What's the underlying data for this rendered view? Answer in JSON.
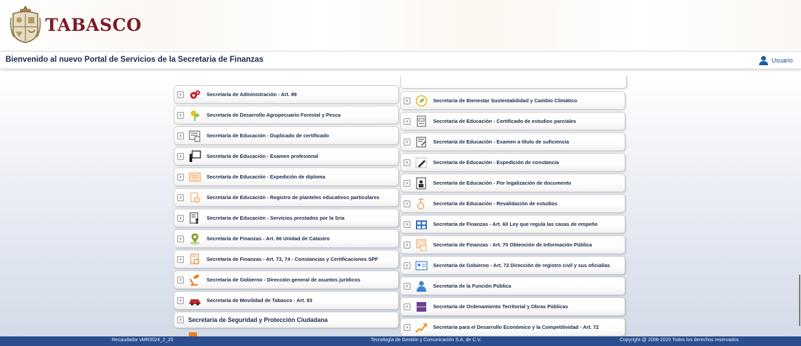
{
  "brand": {
    "name": "TABASCO"
  },
  "welcome": {
    "text": "Bienvenido al nuevo Portal de Servicios de la Secretaria de Finanzas"
  },
  "user": {
    "label": "Usuario",
    "icon": "user-icon"
  },
  "services_left": [
    {
      "label": "Secretaría de Administración - Art. 89",
      "icon": "gears-icon",
      "color": "#c4262e"
    },
    {
      "label": "Secretaría de Desarrollo Agropecuario Forestal y Pesca",
      "icon": "plant-icon",
      "color": "#ecc01d"
    },
    {
      "label": "Secretaría de Educación - Duplicado de certificado",
      "icon": "certificate-icon",
      "color": "#555555"
    },
    {
      "label": "Secretaría de Educación - Examen profesional",
      "icon": "presentation-icon",
      "color": "#2a2a2a"
    },
    {
      "label": "Secretaría de Educación - Expedición de diploma",
      "icon": "diploma-icon",
      "color": "#f0a360"
    },
    {
      "label": "Secretaría de Educación - Registro de planteles educativos particulares",
      "icon": "document-check-icon",
      "color": "#f0a360"
    },
    {
      "label": "Secretaría de Educación - Servicios prestados por la Sria",
      "icon": "document-person-icon",
      "color": "#333333"
    },
    {
      "label": "Secretaría de Finanzas - Art. 66 Unidad de Catastro",
      "icon": "map-pin-icon",
      "color": "#8aa030"
    },
    {
      "label": "Secretaría de Finanzas - Art. 73, 74 - Constancias y Certificaciones SPF",
      "icon": "certificate-seal-icon",
      "color": "#ee7d33"
    },
    {
      "label": "Secretaría de Gobierno - Dirección general de asuntos jurídicos",
      "icon": "gavel-icon",
      "color": "#f07e1e"
    },
    {
      "label": "Secretaría de Movilidad de Tabasco - Art. 93",
      "icon": "car-icon",
      "color": "#c4262e"
    },
    {
      "label": "Secretaría de Seguridad y Protección Ciudadana",
      "icon": "",
      "color": ""
    }
  ],
  "services_right": [
    {
      "label": "Secretaría de Bienestar Sustentabilidad y Cambio Climático",
      "icon": "eco-icon",
      "color": "#e3b726"
    },
    {
      "label": "Secretaría de Educación - Certificado de estudios parciales",
      "icon": "certificate-icon",
      "color": "#555555"
    },
    {
      "label": "Secretaría de Educación - Examen a título de suficiencia",
      "icon": "exam-icon",
      "color": "#444444"
    },
    {
      "label": "Secretaría de Educación - Expedición de constancia",
      "icon": "pen-icon",
      "color": "#333333"
    },
    {
      "label": "Secretaría de Educación - Por legalización de documento",
      "icon": "legal-document-icon",
      "color": "#333333"
    },
    {
      "label": "Secretaría de Educación - Revalidación de estudios",
      "icon": "validation-icon",
      "color": "#e79b5a"
    },
    {
      "label": "Secretaría de Finanzas - Art. 60 Ley que regula las casas de empeño",
      "icon": "building-icon",
      "color": "#2a6cc6"
    },
    {
      "label": "Secretaría de Finanzas - Art. 70 Obtención de Información Pública",
      "icon": "public-info-icon",
      "color": "#f0a360"
    },
    {
      "label": "Secretaría de Gobierno - Art. 72 Dirección de registro civil y sus oficialías",
      "icon": "id-card-icon",
      "color": "#3a83d5"
    },
    {
      "label": "Secretaría de la Función Pública",
      "icon": "person-icon",
      "color": "#3a83d5"
    },
    {
      "label": "Secretaría de Ordenamiento Territorial y Obras Públicas",
      "icon": "block-icon",
      "color": "#6d3f8f"
    },
    {
      "label": "Secretaría para el Desarrollo Económico y la Competitividad - Art. 72",
      "icon": "growth-icon",
      "color": "#f09a1e"
    }
  ],
  "footer": {
    "version": "Recaudador vMR0024_2_20",
    "company": "Tecnología de Gestión y Comunicación S.A. de C.V.",
    "copyright": "Copyright @ 2006-2020 Todos los derechos reservados"
  }
}
